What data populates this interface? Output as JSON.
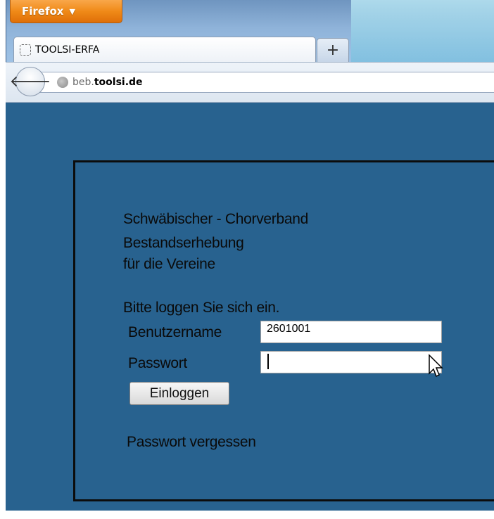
{
  "browser": {
    "menu_button": "Firefox",
    "tab": {
      "title": "TOOLSI-ERFA"
    },
    "new_tab_label": "+",
    "url": {
      "subdomain": "beb.",
      "domain": "toolsi.de"
    },
    "icons": {
      "back": "back-arrow-icon",
      "site": "globe-icon",
      "favicon": "dashed-page-icon"
    }
  },
  "page": {
    "background_color": "#28628f",
    "heading": {
      "line1": "Schwäbischer - Chorverband",
      "line2": "Bestandserhebung",
      "line3": "für die Vereine"
    },
    "prompt": "Bitte loggen Sie sich ein.",
    "form": {
      "username_label": "Benutzername",
      "username_value": "2601001",
      "password_label": "Passwort",
      "password_value": "",
      "submit_label": "Einloggen"
    },
    "forgot_link": "Passwort vergessen"
  }
}
